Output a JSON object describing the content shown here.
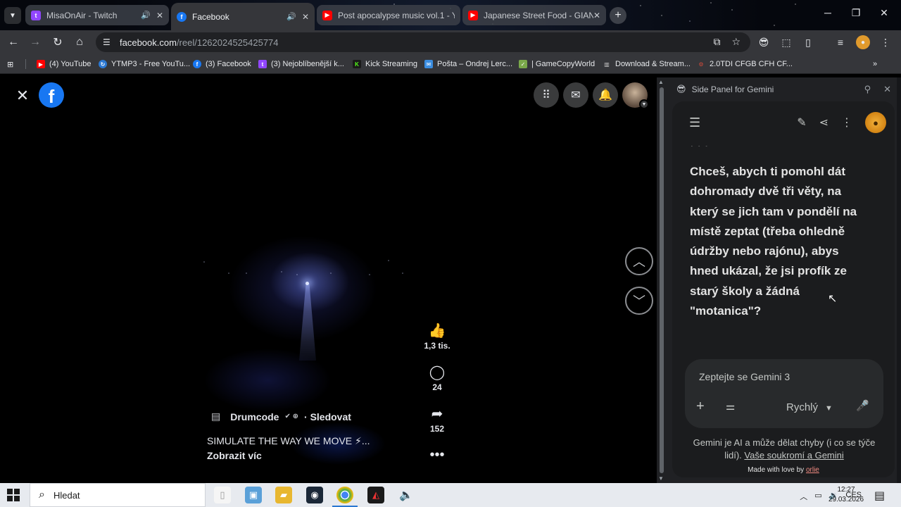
{
  "browser": {
    "tabs": [
      {
        "title": "MisaOnAir - Twitch",
        "favicon": "twitch-icon",
        "color": "#9146ff",
        "audio": true,
        "active": false
      },
      {
        "title": "Facebook",
        "favicon": "facebook-icon",
        "color": "#1877f2",
        "audio": true,
        "active": true
      },
      {
        "title": "Post apocalypse music vol.1 - Y",
        "favicon": "youtube-icon",
        "color": "#ff0000",
        "audio": false,
        "active": false
      },
      {
        "title": "Japanese Street Food - GIANT",
        "favicon": "youtube-icon",
        "color": "#ff0000",
        "audio": false,
        "active": false
      }
    ],
    "url": {
      "host": "facebook.com",
      "path": "/reel/1262024525425774"
    },
    "bookmarks": [
      {
        "label": "(4) YouTube",
        "icon": "youtube-icon",
        "color": "#ff0000"
      },
      {
        "label": "YTMP3 - Free YouTu...",
        "icon": "ytmp3-icon",
        "color": "#2b78d2"
      },
      {
        "label": "(3) Facebook",
        "icon": "facebook-icon",
        "color": "#1877f2"
      },
      {
        "label": "(3) Nejoblíbenější k...",
        "icon": "twitch-icon",
        "color": "#9146ff"
      },
      {
        "label": "Kick Streaming",
        "icon": "kick-icon",
        "color": "#53fc18"
      },
      {
        "label": "Pošta – Ondrej Lerc...",
        "icon": "mail-icon",
        "color": "#3b8de0"
      },
      {
        "label": "| GameCopyWorld",
        "icon": "gamecopyworld-icon",
        "color": "#7aa84a"
      },
      {
        "label": "Download & Stream...",
        "icon": "library-icon",
        "color": "#c8c8c8"
      },
      {
        "label": "2.0TDI CFGB CFH CF...",
        "icon": "engine-icon",
        "color": "#d04a3a"
      }
    ]
  },
  "reel": {
    "author": "Drumcode",
    "follow_label": "· Sledovat",
    "caption": "SIMULATE THE WAY WE MOVE ⚡...",
    "more_label": "Zobrazit víc",
    "likes": "1,3 tis.",
    "comments": "24",
    "shares": "152"
  },
  "gemini": {
    "panel_title": "Side Panel for Gemini",
    "message_lines": [
      "Chceš, abych ti pomohl dát",
      "dohromady dvě tři věty, na",
      "který se jich tam v pondělí na",
      "místě zeptat (třeba ohledně",
      "údržby nebo rajónu), abys",
      "hned ukázal, že jsi profík ze",
      "starý školy a žádná",
      "\"motanica\"?"
    ],
    "input_placeholder": "Zeptejte se Gemini 3",
    "mode_label": "Rychlý",
    "disclaimer_line1": "Gemini je AI a může dělat chyby (i co se týče",
    "disclaimer_prefix": "lidí). ",
    "privacy_link": "Vaše soukromí a Gemini",
    "made_with": "Made with love by ",
    "made_by": "orlie"
  },
  "taskbar": {
    "search_placeholder": "Hledat",
    "language": "CES",
    "time": "12:27",
    "date": "29.03.2026"
  }
}
